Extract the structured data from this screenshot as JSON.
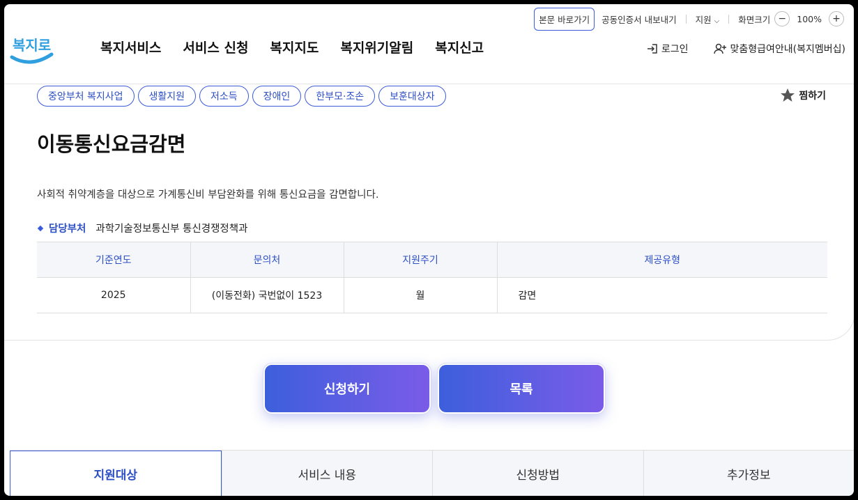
{
  "util": {
    "skip": "본문 바로가기",
    "cert": "공동인증서 내보내기",
    "region": "지원",
    "zoom_label": "화면크기",
    "zoom_minus": "−",
    "zoom_value": "100%",
    "zoom_plus": "+"
  },
  "logo": {
    "text": "복지로"
  },
  "nav": {
    "items": [
      "복지서비스",
      "서비스 신청",
      "복지지도",
      "복지위기알림",
      "복지신고"
    ]
  },
  "header_right": {
    "login": "로그인",
    "membership": "맞춤형급여안내(복지멤버십)"
  },
  "tags": [
    "중앙부처 복지사업",
    "생활지원",
    "저소득",
    "장애인",
    "한부모·조손",
    "보훈대상자"
  ],
  "favorite": "찜하기",
  "title": "이동통신요금감면",
  "description": "사회적 취약계층을 대상으로 가계통신비 부담완화를 위해 통신요금을 감면합니다.",
  "department": {
    "label": "담당부처",
    "value": "과학기술정보통신부 통신경쟁정책과"
  },
  "info_table": {
    "headers": [
      "기준연도",
      "문의처",
      "지원주기",
      "제공유형"
    ],
    "row": [
      "2025",
      "(이동전화) 국번없이 1523",
      "월",
      "감면"
    ]
  },
  "buttons": {
    "apply": "신청하기",
    "list": "목록"
  },
  "tabs": [
    "지원대상",
    "서비스 내용",
    "신청방법",
    "추가정보"
  ],
  "colors": {
    "accent": "#3a5bd9",
    "button_start": "#3d5fdc",
    "button_end": "#7a5ce8"
  }
}
